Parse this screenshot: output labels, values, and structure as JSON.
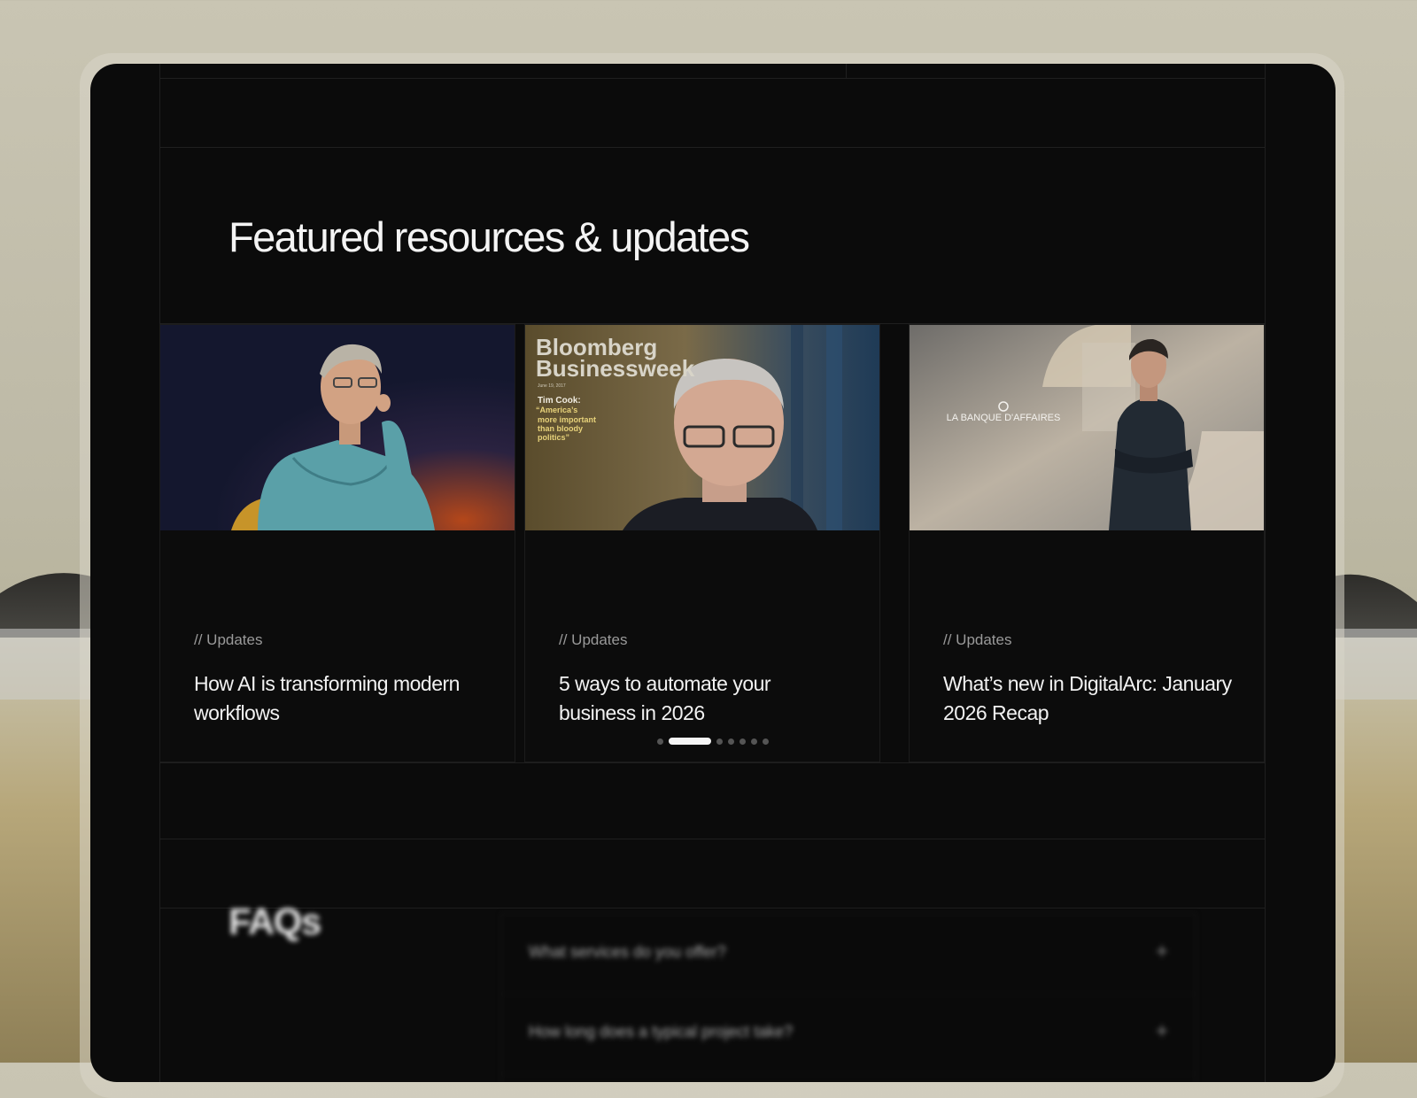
{
  "section": {
    "title": "Featured resources & updates"
  },
  "cards": [
    {
      "tag": "// Updates",
      "title": "How AI is transforming modern workflows"
    },
    {
      "tag": "// Updates",
      "title": "5 ways to automate your business in 2026",
      "magazine": {
        "brand_line1": "Bloomberg",
        "brand_line2": "Businessweek",
        "date": "June 19, 2017",
        "cover_lines": [
          "Tim Cook:",
          "“America’s",
          "more important",
          "than bloody",
          "politics”"
        ]
      }
    },
    {
      "tag": "// Updates",
      "title": "What’s new in DigitalArc: January 2026 Recap",
      "logo_text": "LA BANQUE D'AFFAIRES"
    }
  ],
  "pagination": {
    "total": 7,
    "active_index": 1
  },
  "faqs": {
    "title": "FAQs",
    "items": [
      {
        "question": "What services do you offer?",
        "icon": "+"
      },
      {
        "question": "How long does a typical project take?",
        "icon": "+"
      }
    ]
  },
  "colors": {
    "screen_bg": "#0b0b0b",
    "text_primary": "#f2f2f2",
    "text_muted": "#9a9a9a",
    "dot_active": "#f5f5f5",
    "dot_inactive": "#555555"
  }
}
